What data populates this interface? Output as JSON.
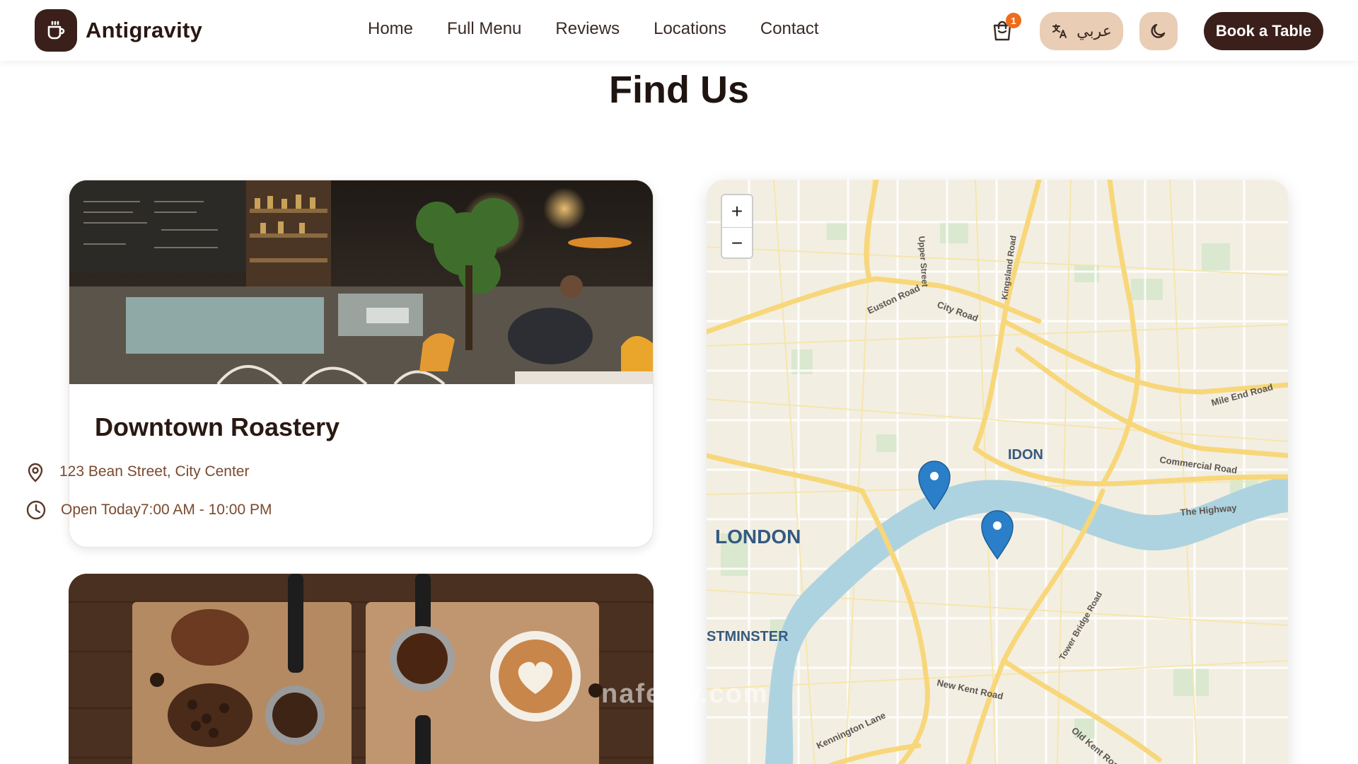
{
  "brand": {
    "name": "Antigravity",
    "logo_icon": "coffee-cup-icon"
  },
  "nav": {
    "items": [
      {
        "label": "Home"
      },
      {
        "label": "Full Menu"
      },
      {
        "label": "Reviews"
      },
      {
        "label": "Locations"
      },
      {
        "label": "Contact"
      }
    ]
  },
  "header_actions": {
    "cart_icon": "shopping-bag-icon",
    "cart_count": "1",
    "language_icon": "translate-icon",
    "language_label": "عربي",
    "theme_icon": "moon-icon",
    "book_label": "Book a Table"
  },
  "section": {
    "title": "Find Us"
  },
  "locations": [
    {
      "name": "Downtown Roastery",
      "address": "123 Bean Street, City Center",
      "hours": "Open Today7:00 AM - 10:00 PM",
      "address_icon": "map-pin-icon",
      "hours_icon": "clock-icon"
    }
  ],
  "map": {
    "zoom_in_label": "+",
    "zoom_out_label": "−",
    "labels": {
      "london": "LONDON",
      "idon": "IDON",
      "westminster": "STMINSTER",
      "city_road": "City Road",
      "euston_road": "Euston Road",
      "kingsland_road": "Kingsland Road",
      "upper_street": "Upper Street",
      "mile_end_road": "Mile End Road",
      "commercial_road": "Commercial Road",
      "the_highway": "The Highway",
      "tower_bridge_road": "Tower Bridge Road",
      "new_kent_road": "New Kent Road",
      "kennington_lane": "Kennington Lane",
      "old_kent_road": "Old Kent Road"
    },
    "marker_color": "#2a7fc8"
  },
  "watermark": "nafezly.com",
  "colors": {
    "brand_dark": "#3a1f1a",
    "accent_tan": "#e9cdb4",
    "badge_orange": "#ef6c1a",
    "info_brown": "#7a4a2e"
  }
}
